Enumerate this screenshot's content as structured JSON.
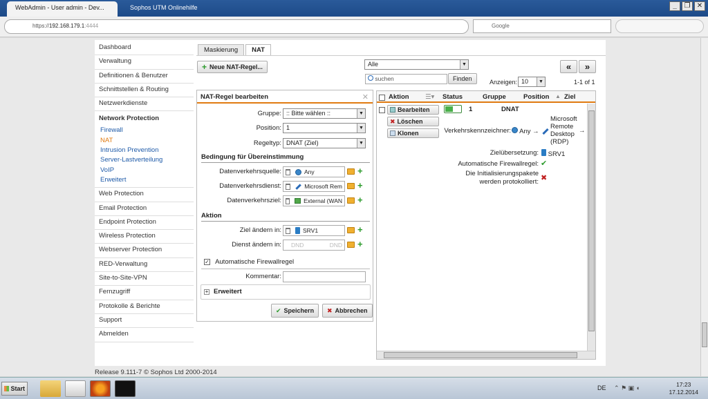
{
  "browser": {
    "tab_active": "WebAdmin - User admin - Dev...",
    "tab_inactive": "Sophos UTM Onlinehilfe",
    "url_proto": "https://",
    "url_host": "192.168.179.1",
    "url_port": ":4444",
    "search_placeholder": "Google",
    "win_minimize": "_",
    "win_restore": "❐",
    "win_close": "✕"
  },
  "sidebar": {
    "items_top": [
      "Dashboard",
      "Verwaltung",
      "Definitionen & Benutzer",
      "Schnittstellen & Routing",
      "Netzwerkdienste"
    ],
    "group_title": "Network Protection",
    "group_items": [
      "Firewall",
      "NAT",
      "Intrusion Prevention",
      "Server-Lastverteilung",
      "VoIP",
      "Erweitert"
    ],
    "active_item": "NAT",
    "items_bottom": [
      "Web Protection",
      "Email Protection",
      "Endpoint Protection",
      "Wireless Protection",
      "Webserver Protection",
      "RED-Verwaltung",
      "Site-to-Site-VPN",
      "Fernzugriff",
      "Protokolle & Berichte",
      "Support",
      "Abmelden"
    ]
  },
  "tabs": [
    "Maskierung",
    "NAT"
  ],
  "toolbar": {
    "new_rule": "Neue NAT-Regel...",
    "filter_value": "Alle",
    "search_placeholder": "suchen",
    "find_button": "Finden",
    "show_label": "Anzeigen:",
    "show_value": "10",
    "paging": "1-1 of 1",
    "prev": "«",
    "next": "»"
  },
  "editor": {
    "title": "NAT-Regel bearbeiten",
    "close": "✕",
    "group_label": "Gruppe:",
    "group_value": ":: Bitte wählen ::",
    "position_label": "Position:",
    "position_value": "1",
    "ruletype_label": "Regeltyp:",
    "ruletype_value": "DNAT (Ziel)",
    "section_match": "Bedingung für Übereinstimmung",
    "src_label": "Datenverkehrsquelle:",
    "src_value": "Any",
    "svc_label": "Datenverkehrsdienst:",
    "svc_value": "Microsoft Rem",
    "dst_label": "Datenverkehrsziel:",
    "dst_value": "External (WAN",
    "section_action": "Aktion",
    "change_dst_label": "Ziel ändern in:",
    "change_dst_value": "SRV1",
    "change_svc_label": "Dienst ändern in:",
    "change_svc_placeholder": "DND",
    "change_svc_placeholder2": "DND",
    "auto_fw_label": "Automatische Firewallregel",
    "auto_fw_checked": "✓",
    "comment_label": "Kommentar:",
    "advanced": "Erweitert",
    "advanced_toggle": "+",
    "save": "Speichern",
    "cancel": "Abbrechen"
  },
  "grid": {
    "headers": [
      "Aktion",
      "Status",
      "Gruppe",
      "Position",
      "Ziel"
    ],
    "sort_indicator": "▲",
    "row": {
      "edit": "Bearbeiten",
      "delete": "Löschen",
      "clone": "Klonen",
      "position": "1",
      "type": "DNAT",
      "traffic_label": "Verkehrskennzeichner:",
      "traffic_src": "Any",
      "traffic_svc": "Microsoft Remote Desktop (RDP)",
      "arrow": "→",
      "translation_label": "Zielübersetzung:",
      "translation_value": "SRV1",
      "auto_fw_label": "Automatische Firewallregel:",
      "log_label_1": "Die Initialisierungspakete",
      "log_label_2": "werden protokolliert:"
    }
  },
  "footer": "Release 9.111-7  © Sophos Ltd 2000-2014",
  "taskbar": {
    "start": "Start",
    "lang": "DE",
    "time": "17:23",
    "date": "17.12.2014"
  },
  "colors": {
    "accent": "#e07a10",
    "link": "#1e5aa8",
    "ok": "#2d9b2d",
    "error": "#c02020"
  }
}
